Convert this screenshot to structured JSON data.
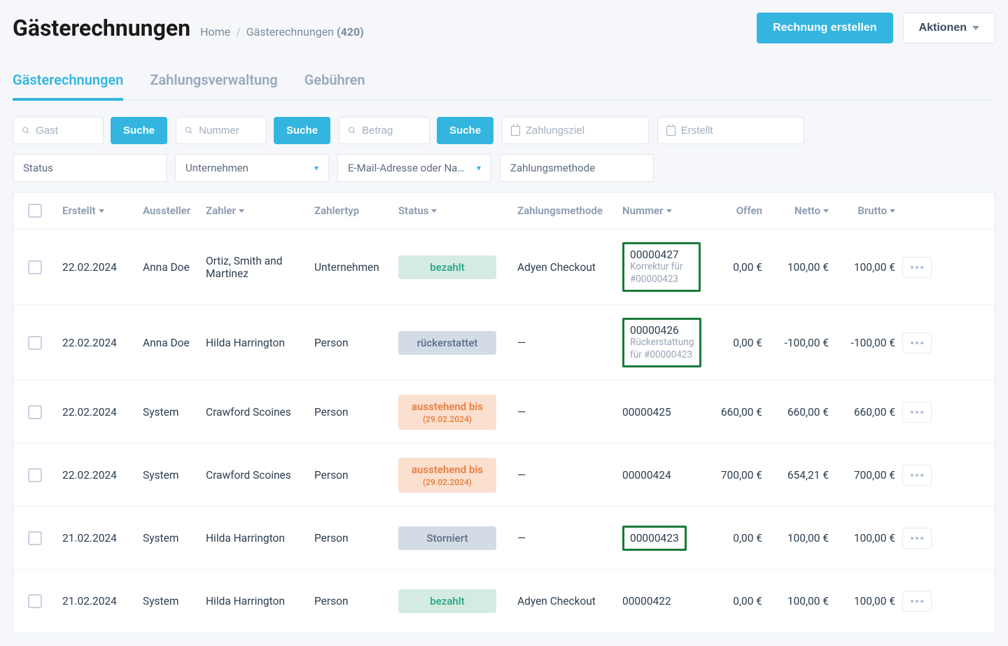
{
  "header": {
    "title": "Gästerechnungen",
    "breadcrumb": {
      "home": "Home",
      "current": "Gästerechnungen",
      "count": "(420)"
    },
    "create_btn": "Rechnung erstellen",
    "actions_btn": "Aktionen"
  },
  "tabs": [
    {
      "label": "Gästerechnungen",
      "active": true
    },
    {
      "label": "Zahlungsverwaltung",
      "active": false
    },
    {
      "label": "Gebühren",
      "active": false
    }
  ],
  "filters": {
    "guest_placeholder": "Gast",
    "number_placeholder": "Nummer",
    "amount_placeholder": "Betrag",
    "search_label": "Suche",
    "due_placeholder": "Zahlungsziel",
    "created_placeholder": "Erstellt",
    "status_placeholder": "Status",
    "company_placeholder": "Unternehmen",
    "email_placeholder": "E-Mail-Adresse oder Na…",
    "payment_method_placeholder": "Zahlungsmethode"
  },
  "columns": {
    "created": "Erstellt",
    "issuer": "Aussteller",
    "payer": "Zahler",
    "payer_type": "Zahlertyp",
    "status": "Status",
    "payment_method": "Zahlungsmethode",
    "number": "Nummer",
    "open": "Offen",
    "net": "Netto",
    "gross": "Brutto"
  },
  "rows": [
    {
      "created": "22.02.2024",
      "issuer": "Anna Doe",
      "payer": "Ortiz, Smith and Martinez",
      "payer_type": "Unternehmen",
      "status": {
        "label": "bezahlt",
        "kind": "paid"
      },
      "payment_method": "Adyen Checkout",
      "number": "00000427",
      "number_sub": "Korrektur für #00000423",
      "number_highlight": true,
      "open": "0,00 €",
      "net": "100,00 €",
      "gross": "100,00 €"
    },
    {
      "created": "22.02.2024",
      "issuer": "Anna Doe",
      "payer": "Hilda Harrington",
      "payer_type": "Person",
      "status": {
        "label": "rückerstattet",
        "kind": "refund"
      },
      "payment_method": "—",
      "number": "00000426",
      "number_sub": "Rückerstattung für #00000423",
      "number_highlight": true,
      "open": "0,00 €",
      "net": "-100,00 €",
      "gross": "-100,00 €"
    },
    {
      "created": "22.02.2024",
      "issuer": "System",
      "payer": "Crawford Scoines",
      "payer_type": "Person",
      "status": {
        "label": "ausstehend bis",
        "sub": "(29.02.2024)",
        "kind": "pending"
      },
      "payment_method": "—",
      "number": "00000425",
      "open": "660,00 €",
      "net": "660,00 €",
      "gross": "660,00 €"
    },
    {
      "created": "22.02.2024",
      "issuer": "System",
      "payer": "Crawford Scoines",
      "payer_type": "Person",
      "status": {
        "label": "ausstehend bis",
        "sub": "(29.02.2024)",
        "kind": "pending"
      },
      "payment_method": "—",
      "number": "00000424",
      "open": "700,00 €",
      "net": "654,21 €",
      "gross": "700,00 €"
    },
    {
      "created": "21.02.2024",
      "issuer": "System",
      "payer": "Hilda Harrington",
      "payer_type": "Person",
      "status": {
        "label": "Storniert",
        "kind": "cancel"
      },
      "payment_method": "—",
      "number": "00000423",
      "number_highlight": true,
      "open": "0,00 €",
      "net": "100,00 €",
      "gross": "100,00 €"
    },
    {
      "created": "21.02.2024",
      "issuer": "System",
      "payer": "Hilda Harrington",
      "payer_type": "Person",
      "status": {
        "label": "bezahlt",
        "kind": "paid"
      },
      "payment_method": "Adyen Checkout",
      "number": "00000422",
      "open": "0,00 €",
      "net": "100,00 €",
      "gross": "100,00 €"
    }
  ]
}
